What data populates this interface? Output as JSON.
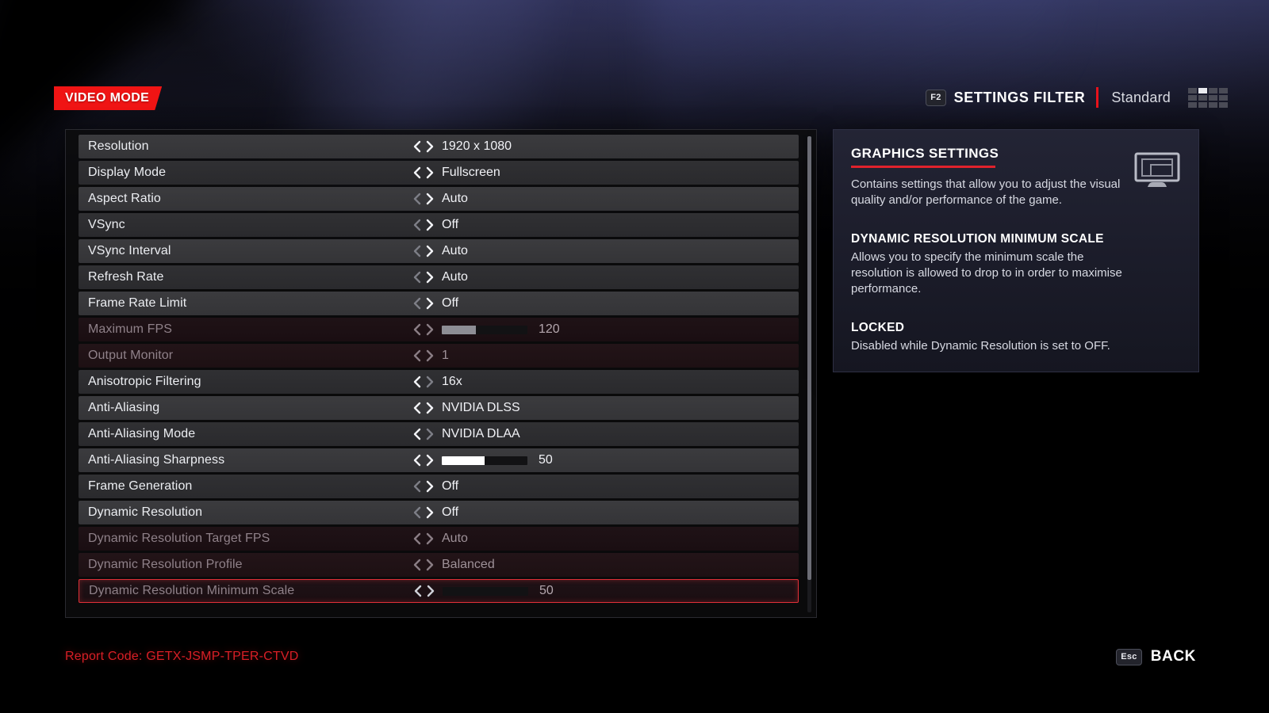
{
  "header": {
    "tab_label": "VIDEO MODE",
    "filter_key": "F2",
    "filter_title": "SETTINGS FILTER",
    "filter_value": "Standard",
    "accent_red": "#f01414",
    "filter_grid_cells": 12,
    "filter_grid_active_index": 1
  },
  "settings": {
    "rows": [
      {
        "label": "Resolution",
        "value": "1920 x 1080",
        "type": "option",
        "disabled": false,
        "selected": false,
        "left_arrow_dim": false,
        "right_arrow_dim": false
      },
      {
        "label": "Display Mode",
        "value": "Fullscreen",
        "type": "option",
        "disabled": false,
        "selected": false,
        "left_arrow_dim": false,
        "right_arrow_dim": false
      },
      {
        "label": "Aspect Ratio",
        "value": "Auto",
        "type": "option",
        "disabled": false,
        "selected": false,
        "left_arrow_dim": true,
        "right_arrow_dim": false
      },
      {
        "label": "VSync",
        "value": "Off",
        "type": "option",
        "disabled": false,
        "selected": false,
        "left_arrow_dim": true,
        "right_arrow_dim": false
      },
      {
        "label": "VSync Interval",
        "value": "Auto",
        "type": "option",
        "disabled": false,
        "selected": false,
        "left_arrow_dim": true,
        "right_arrow_dim": false
      },
      {
        "label": "Refresh Rate",
        "value": "Auto",
        "type": "option",
        "disabled": false,
        "selected": false,
        "left_arrow_dim": true,
        "right_arrow_dim": false
      },
      {
        "label": "Frame Rate Limit",
        "value": "Off",
        "type": "option",
        "disabled": false,
        "selected": false,
        "left_arrow_dim": true,
        "right_arrow_dim": false
      },
      {
        "label": "Maximum FPS",
        "value": "120",
        "type": "slider",
        "fill_percent": 40,
        "disabled": true,
        "selected": false,
        "left_arrow_dim": false,
        "right_arrow_dim": false
      },
      {
        "label": "Output Monitor",
        "value": "1",
        "type": "option",
        "disabled": true,
        "selected": false,
        "left_arrow_dim": false,
        "right_arrow_dim": false
      },
      {
        "label": "Anisotropic Filtering",
        "value": "16x",
        "type": "option",
        "disabled": false,
        "selected": false,
        "left_arrow_dim": false,
        "right_arrow_dim": true
      },
      {
        "label": "Anti-Aliasing",
        "value": "NVIDIA DLSS",
        "type": "option",
        "disabled": false,
        "selected": false,
        "left_arrow_dim": false,
        "right_arrow_dim": false
      },
      {
        "label": "Anti-Aliasing Mode",
        "value": "NVIDIA DLAA",
        "type": "option",
        "disabled": false,
        "selected": false,
        "left_arrow_dim": false,
        "right_arrow_dim": true
      },
      {
        "label": "Anti-Aliasing Sharpness",
        "value": "50",
        "type": "slider",
        "fill_percent": 50,
        "disabled": false,
        "selected": false,
        "left_arrow_dim": false,
        "right_arrow_dim": false
      },
      {
        "label": "Frame Generation",
        "value": "Off",
        "type": "option",
        "disabled": false,
        "selected": false,
        "left_arrow_dim": true,
        "right_arrow_dim": false
      },
      {
        "label": "Dynamic Resolution",
        "value": "Off",
        "type": "option",
        "disabled": false,
        "selected": false,
        "left_arrow_dim": true,
        "right_arrow_dim": false
      },
      {
        "label": "Dynamic Resolution Target FPS",
        "value": "Auto",
        "type": "option",
        "disabled": true,
        "selected": false,
        "left_arrow_dim": false,
        "right_arrow_dim": false
      },
      {
        "label": "Dynamic Resolution Profile",
        "value": "Balanced",
        "type": "option",
        "disabled": true,
        "selected": false,
        "left_arrow_dim": false,
        "right_arrow_dim": false
      },
      {
        "label": "Dynamic Resolution Minimum Scale",
        "value": "50",
        "type": "slider",
        "fill_percent": 0,
        "disabled": true,
        "selected": true,
        "left_arrow_dim": false,
        "right_arrow_dim": false
      }
    ]
  },
  "info": {
    "category_title": "GRAPHICS SETTINGS",
    "category_description": "Contains settings that allow you to adjust the visual quality and/or performance of the game.",
    "setting_title": "DYNAMIC RESOLUTION MINIMUM SCALE",
    "setting_description": "Allows you to specify the minimum scale the resolution is allowed to drop to in order to maximise performance.",
    "locked_title": "LOCKED",
    "locked_description": "Disabled while Dynamic Resolution is set to OFF.",
    "icon_name": "monitor-icon",
    "rule_color": "#e0222c"
  },
  "footer": {
    "report_code": "Report Code: GETX-JSMP-TPER-CTVD",
    "report_code_color": "#d81f26",
    "back_key": "Esc",
    "back_label": "BACK"
  }
}
